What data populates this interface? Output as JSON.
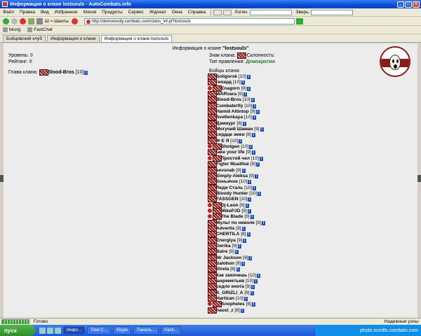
{
  "window": {
    "title": "Информация о клане lostsouls - AutoCombats.info"
  },
  "menu": {
    "items": [
      "Файл",
      "Правка",
      "Вид",
      "Избранное",
      "Магия",
      "Продукты",
      "Сервис",
      "Журнал",
      "Окна",
      "Справка"
    ],
    "login_label": "Логин:",
    "beast_label": "Зверь:"
  },
  "toolbar": {
    "mode_label": "Ш ≈ Шаоты",
    "url": "http://demonsoity.combats.com/clans_inf.pl?lostsouls"
  },
  "links": [
    {
      "label": "bkorg"
    },
    {
      "label": "FastChat"
    }
  ],
  "tabs": [
    {
      "label": "Бойцовский клуб"
    },
    {
      "label": "Информация о клане"
    },
    {
      "label": "Информация о клане lostsouls"
    }
  ],
  "page": {
    "title_prefix": "Информация о клане ",
    "clan_name": "\"lostsouls\"",
    "level_label": "Уровень:",
    "level_value": "0",
    "rating_label": "Рейтинг:",
    "rating_value": "0",
    "clan_sign_label": "Знак клана:",
    "alignment_label": "Склонность:",
    "government_label": "Тип правления:",
    "government_value": "Демократия",
    "head_label": "Глава клана:",
    "head_name": "Blood-Bros",
    "head_level": "[10]",
    "members_label": "Бойцы клана:"
  },
  "members": [
    {
      "name": "Soligorsk",
      "level": "[10]",
      "dot": false
    },
    {
      "name": "гепард",
      "level": "[10]",
      "dot": false
    },
    {
      "name": "Enagorn",
      "level": "[9]",
      "dot": true
    },
    {
      "name": "WARvara",
      "level": "[9]",
      "dot": false
    },
    {
      "name": "Blood-Bros",
      "level": "[10]",
      "dot": false
    },
    {
      "name": "Combaterfly",
      "level": "[10]",
      "dot": false
    },
    {
      "name": "Hamid Altintop",
      "level": "[9]",
      "dot": false
    },
    {
      "name": "Svetlenkaya",
      "level": "[10]",
      "dot": false
    },
    {
      "name": "Дэмиург",
      "level": "[8]",
      "dot": false
    },
    {
      "name": "Могучий Шаман",
      "level": "[9]",
      "dot": false
    },
    {
      "name": "сердце змеи",
      "level": "[8]",
      "dot": false
    },
    {
      "name": "Ф Е Я",
      "level": "[10]",
      "dot": false
    },
    {
      "name": "Shotgan",
      "level": "[10]",
      "dot": true
    },
    {
      "name": "take your life",
      "level": "[9]",
      "dot": false
    },
    {
      "name": "Простой чел",
      "level": "[10]",
      "dot": true
    },
    {
      "name": "Figter Muaithai",
      "level": "[9]",
      "dot": false
    },
    {
      "name": "sevsnab",
      "level": "[9]",
      "dot": false
    },
    {
      "name": "Simply-Aleksa",
      "level": "[9]",
      "dot": false
    },
    {
      "name": "Коньячок",
      "level": "[10]",
      "dot": false
    },
    {
      "name": "Леди Сталь",
      "level": "[10]",
      "dot": false
    },
    {
      "name": "Bloody Hunter",
      "level": "[10]",
      "dot": false
    },
    {
      "name": "FASSGEN",
      "level": "[10]",
      "dot": false
    },
    {
      "name": "Dj-Leon",
      "level": "[9]",
      "dot": true
    },
    {
      "name": "MikePJD",
      "level": "[9]",
      "dot": true
    },
    {
      "name": "The Blade",
      "level": "[9]",
      "dot": true
    },
    {
      "name": "Мульт по неволе",
      "level": "[9]",
      "dot": false
    },
    {
      "name": "Advertis",
      "level": "[9]",
      "dot": false
    },
    {
      "name": "CHERTILA",
      "level": "[8]",
      "dot": false
    },
    {
      "name": "Energiya",
      "level": "[9]",
      "dot": false
    },
    {
      "name": "Gerika",
      "level": "[9]",
      "dot": false
    },
    {
      "name": "Baire",
      "level": "[9]",
      "dot": false
    },
    {
      "name": "Mr Jackson",
      "level": "[9]",
      "dot": false
    },
    {
      "name": "Salobon",
      "level": "[9]",
      "dot": false
    },
    {
      "name": "Strela",
      "level": "[8]",
      "dot": false
    },
    {
      "name": "Как захочешь",
      "level": "[10]",
      "dot": false
    },
    {
      "name": "шереметьев",
      "level": "[10]",
      "dot": false
    },
    {
      "name": "седло енота",
      "level": "[9]",
      "dot": false
    },
    {
      "name": "A_GRIZLI_A",
      "level": "[9]",
      "dot": false
    },
    {
      "name": "Hartizan",
      "level": "[10]",
      "dot": false
    },
    {
      "name": "Anopheles",
      "level": "[8]",
      "dot": true
    },
    {
      "name": "haust_z",
      "level": "[8]",
      "dot": false
    }
  ],
  "status": {
    "text": "Готово",
    "secure": "Надежные узлы",
    "progress": 1.0
  },
  "taskbar": {
    "start": "пуск",
    "buttons": [
      "Инфо...",
      "Total C...",
      "Skype",
      "Панель...",
      "Paint..."
    ],
    "tray_text": "photo.scrolls.combats.com"
  },
  "colors": {
    "accent_green": "#2a7a2a",
    "clan_red": "#8b1a1a",
    "info_blue": "#1a4ec0"
  }
}
